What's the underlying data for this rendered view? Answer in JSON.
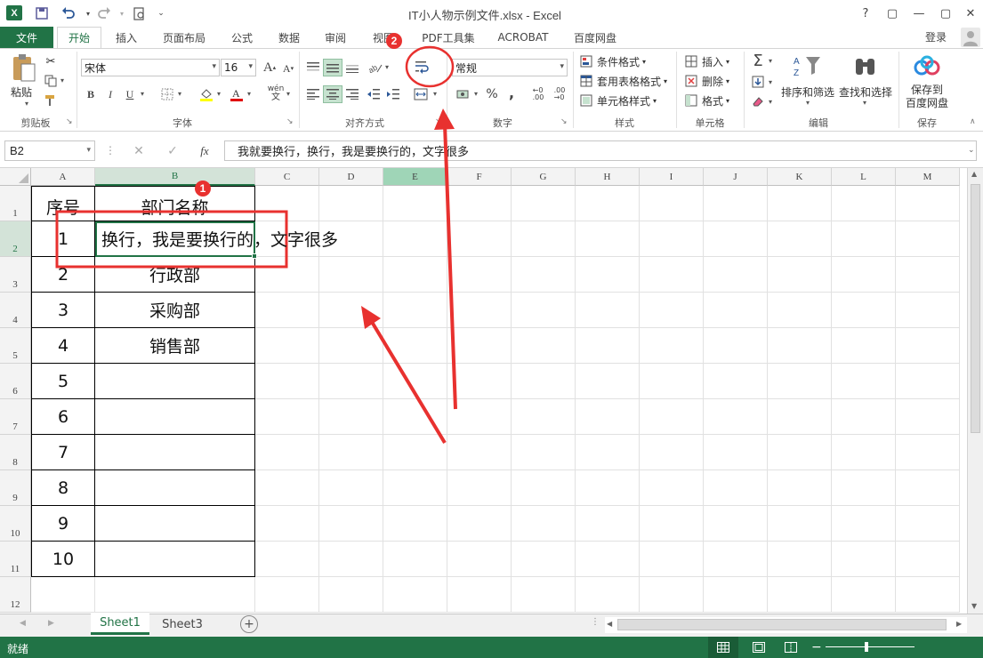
{
  "window": {
    "title": "IT小人物示例文件.xlsx - Excel",
    "app_icon": "X",
    "help": "?",
    "restore_ribbon": "▢",
    "minimize": "—",
    "maximize": "▢",
    "close": "✕"
  },
  "tabs": {
    "file": "文件",
    "items": [
      "开始",
      "插入",
      "页面布局",
      "公式",
      "数据",
      "审阅",
      "视图",
      "PDF工具集",
      "ACROBAT",
      "百度网盘"
    ],
    "active": "开始",
    "login": "登录"
  },
  "ribbon": {
    "clipboard": {
      "paste": "粘贴",
      "label": "剪贴板"
    },
    "font": {
      "name": "宋体",
      "size": "16",
      "bold": "B",
      "italic": "I",
      "underline": "U",
      "wen": "wén",
      "label": "字体"
    },
    "align": {
      "label": "对齐方式"
    },
    "number": {
      "format": "常规",
      "percent": "%",
      "comma": ",",
      "label": "数字"
    },
    "styles": {
      "conditional": "条件格式",
      "table": "套用表格格式",
      "cell": "单元格样式",
      "label": "样式"
    },
    "cells": {
      "insert": "插入",
      "delete": "删除",
      "format": "格式",
      "label": "单元格"
    },
    "editing": {
      "sort": "排序和筛选",
      "find": "查找和选择",
      "label": "编辑"
    },
    "save": {
      "button_line1": "保存到",
      "button_line2": "百度网盘",
      "label": "保存"
    }
  },
  "formula_bar": {
    "name_box": "B2",
    "fx": "fx",
    "content": "我就要换行，换行，我是要换行的，文字很多"
  },
  "grid": {
    "columns": [
      "A",
      "B",
      "C",
      "D",
      "E",
      "F",
      "G",
      "H",
      "I",
      "J",
      "K",
      "L",
      "M"
    ],
    "rows": [
      "1",
      "2",
      "3",
      "4",
      "5",
      "6",
      "7",
      "8",
      "9",
      "10",
      "11",
      "12"
    ],
    "header_a": "序号",
    "header_b": "部门名称",
    "a_values": [
      "1",
      "2",
      "3",
      "4",
      "5",
      "6",
      "7",
      "8",
      "9",
      "10"
    ],
    "b_values": [
      "换行，我是要换行的，文字很多",
      "行政部",
      "采购部",
      "销售部",
      "",
      "",
      "",
      "",
      "",
      ""
    ]
  },
  "sheets": [
    "Sheet1",
    "Sheet3"
  ],
  "active_sheet": "Sheet1",
  "status": {
    "ready": "就绪"
  },
  "annotations": {
    "badge1": "1",
    "badge2": "2"
  },
  "colors": {
    "excel_green": "#217346",
    "annotation_red": "#e8312f",
    "selected_col_header": "#9fd5b7"
  }
}
